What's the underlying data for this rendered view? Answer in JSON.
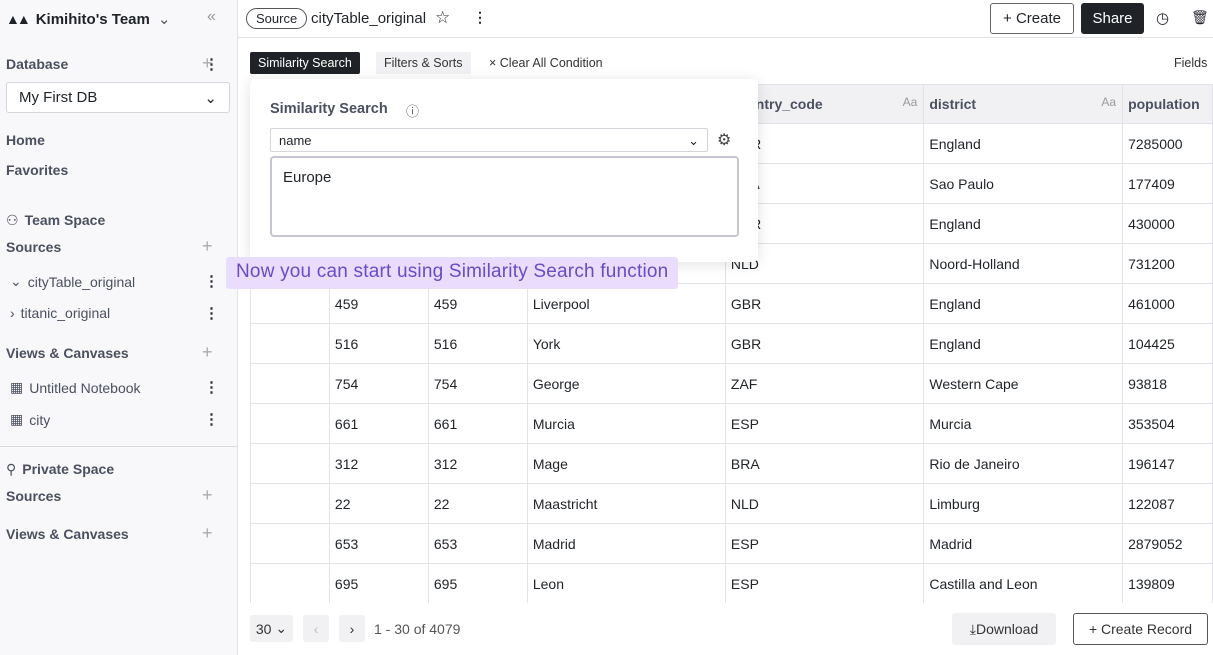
{
  "sidebar": {
    "team": "Kimihito's Team",
    "database_label": "Database",
    "db_selected": "My First DB",
    "home": "Home",
    "favorites": "Favorites",
    "team_space": "Team Space",
    "sources": "Sources",
    "team_sources": [
      {
        "label": "cityTable_original",
        "expanded": true
      },
      {
        "label": "titanic_original",
        "expanded": false
      }
    ],
    "views_label": "Views & Canvases",
    "team_views": [
      "Untitled Notebook",
      "city"
    ],
    "private_space": "Private Space",
    "private_sources": "Sources",
    "private_views": "Views & Canvases"
  },
  "topbar": {
    "badge": "Source",
    "table_name": "cityTable_original",
    "create": "+ Create",
    "share": "Share"
  },
  "toolbar": {
    "similarity": "Similarity Search",
    "filters": "Filters & Sorts",
    "clear": "× Clear All Condition",
    "fields": "Fields"
  },
  "popover": {
    "title": "Similarity Search",
    "field": "name",
    "query": "Europe"
  },
  "tip": "Now you can start using Similarity Search function",
  "table": {
    "headers": [
      "",
      "",
      "",
      "",
      "country_code",
      "district",
      "population"
    ],
    "type_hint": "Aa",
    "rows": [
      [
        "",
        "",
        "",
        "",
        "GBR",
        "England",
        "7285000"
      ],
      [
        "",
        "",
        "",
        "",
        "BRA",
        "Sao Paulo",
        "177409"
      ],
      [
        "",
        "",
        "",
        "",
        "GBR",
        "England",
        "430000"
      ],
      [
        "",
        "",
        "",
        "",
        "NLD",
        "Noord-Holland",
        "731200"
      ],
      [
        "",
        "459",
        "459",
        "Liverpool",
        "GBR",
        "England",
        "461000"
      ],
      [
        "",
        "516",
        "516",
        "York",
        "GBR",
        "England",
        "104425"
      ],
      [
        "",
        "754",
        "754",
        "George",
        "ZAF",
        "Western Cape",
        "93818"
      ],
      [
        "",
        "661",
        "661",
        "Murcia",
        "ESP",
        "Murcia",
        "353504"
      ],
      [
        "",
        "312",
        "312",
        "Mage",
        "BRA",
        "Rio de Janeiro",
        "196147"
      ],
      [
        "",
        "22",
        "22",
        "Maastricht",
        "NLD",
        "Limburg",
        "122087"
      ],
      [
        "",
        "653",
        "653",
        "Madrid",
        "ESP",
        "Madrid",
        "2879052"
      ],
      [
        "",
        "695",
        "695",
        "Leon",
        "ESP",
        "Castilla and Leon",
        "139809"
      ]
    ]
  },
  "footer": {
    "page_size": "30",
    "range": "1 - 30 of 4079",
    "download": "Download",
    "create_record": "+ Create Record"
  },
  "colors": {
    "accent_dark": "#1f2328",
    "tip_bg": "#e9dcfc",
    "tip_text": "#6a4bc4"
  }
}
